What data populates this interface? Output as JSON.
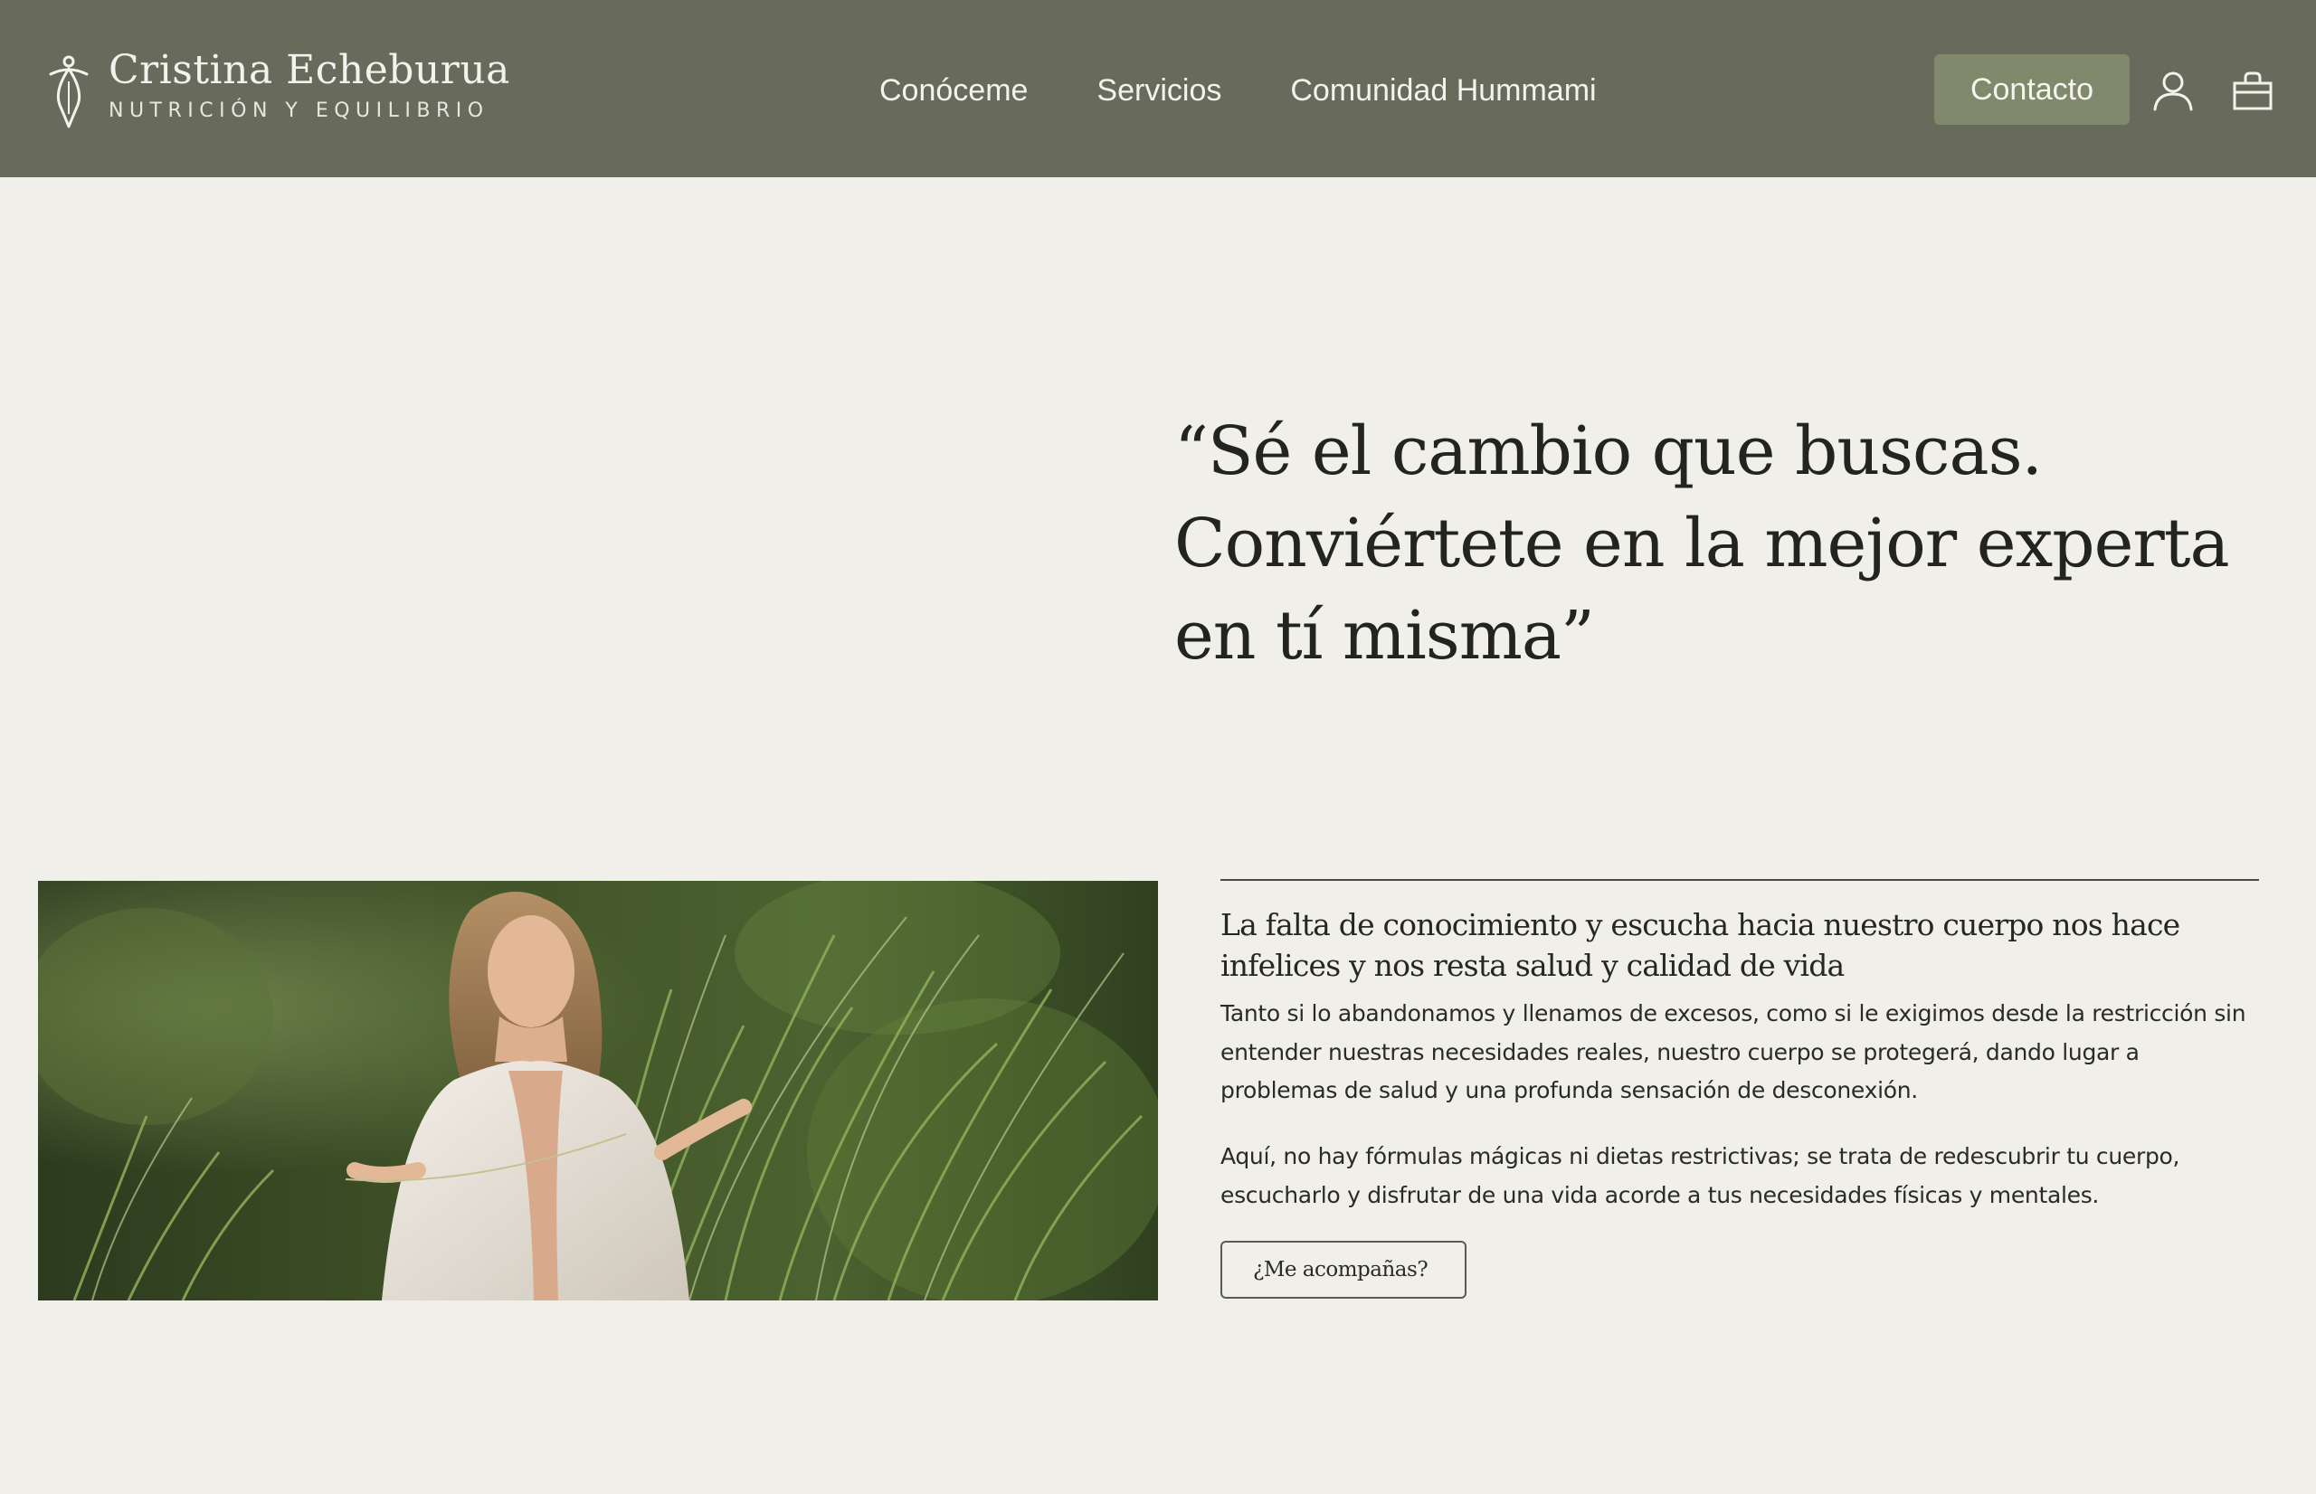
{
  "header": {
    "brand_name": "Cristina Echeburua",
    "brand_tagline": "NUTRICIÓN Y EQUILIBRIO",
    "logo_icon": "figure-logo-icon",
    "nav": [
      {
        "label": "Conóceme"
      },
      {
        "label": "Servicios"
      },
      {
        "label": "Comunidad Hummami"
      }
    ],
    "cta_label": "Contacto",
    "account_icon": "user-icon",
    "cart_icon": "shopping-bag-icon"
  },
  "hero": {
    "quote": "“Sé el cambio que buscas. Conviértete en la mejor experta en tí misma”"
  },
  "intro": {
    "heading": "La falta de conocimiento y escucha hacia nuestro cuerpo nos hace infelices y nos resta salud y calidad de vida",
    "paragraph_1": "Tanto si lo abandonamos y llenamos de excesos, como si le exigimos desde la restricción sin entender nuestras necesidades reales, nuestro cuerpo se protegerá, dando lugar a problemas de salud y una profunda sensación de desconexión.",
    "paragraph_2": "Aquí, no hay fórmulas mágicas ni dietas restrictivas; se trata de redescubrir tu cuerpo, escucharlo y disfrutar de una vida acorde a tus necesidades físicas y mentales.",
    "button_label": "¿Me acompañas?"
  },
  "colors": {
    "header_bg": "#686a5c",
    "cta_bg": "#80896b",
    "page_bg": "#f1efea",
    "text_dark": "#23231f"
  }
}
